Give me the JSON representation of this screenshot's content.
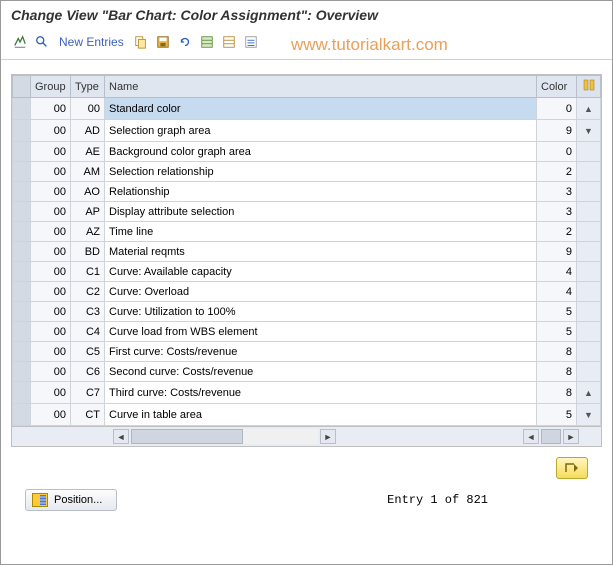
{
  "title": "Change View \"Bar Chart: Color Assignment\": Overview",
  "toolbar": {
    "new_entries": "New Entries"
  },
  "watermark": "www.tutorialkart.com",
  "table": {
    "headers": {
      "group": "Group",
      "type": "Type",
      "name": "Name",
      "color": "Color"
    },
    "rows": [
      {
        "group": "00",
        "type": "00",
        "name": "Standard color",
        "color": "0",
        "selected": true
      },
      {
        "group": "00",
        "type": "AD",
        "name": "Selection graph area",
        "color": "9"
      },
      {
        "group": "00",
        "type": "AE",
        "name": "Background color graph area",
        "color": "0"
      },
      {
        "group": "00",
        "type": "AM",
        "name": "Selection relationship",
        "color": "2"
      },
      {
        "group": "00",
        "type": "AO",
        "name": "Relationship",
        "color": "3"
      },
      {
        "group": "00",
        "type": "AP",
        "name": "Display attribute selection",
        "color": "3"
      },
      {
        "group": "00",
        "type": "AZ",
        "name": "Time line",
        "color": "2"
      },
      {
        "group": "00",
        "type": "BD",
        "name": "Material reqmts",
        "color": "9"
      },
      {
        "group": "00",
        "type": "C1",
        "name": "Curve: Available capacity",
        "color": "4"
      },
      {
        "group": "00",
        "type": "C2",
        "name": "Curve: Overload",
        "color": "4"
      },
      {
        "group": "00",
        "type": "C3",
        "name": "Curve: Utilization to 100%",
        "color": "5"
      },
      {
        "group": "00",
        "type": "C4",
        "name": "Curve load from WBS element",
        "color": "5"
      },
      {
        "group": "00",
        "type": "C5",
        "name": "First curve: Costs/revenue",
        "color": "8"
      },
      {
        "group": "00",
        "type": "C6",
        "name": "Second curve: Costs/revenue",
        "color": "8"
      },
      {
        "group": "00",
        "type": "C7",
        "name": "Third curve: Costs/revenue",
        "color": "8"
      },
      {
        "group": "00",
        "type": "CT",
        "name": "Curve in table area",
        "color": "5"
      }
    ]
  },
  "footer": {
    "position_btn": "Position...",
    "entry_text": "Entry 1 of 821"
  }
}
